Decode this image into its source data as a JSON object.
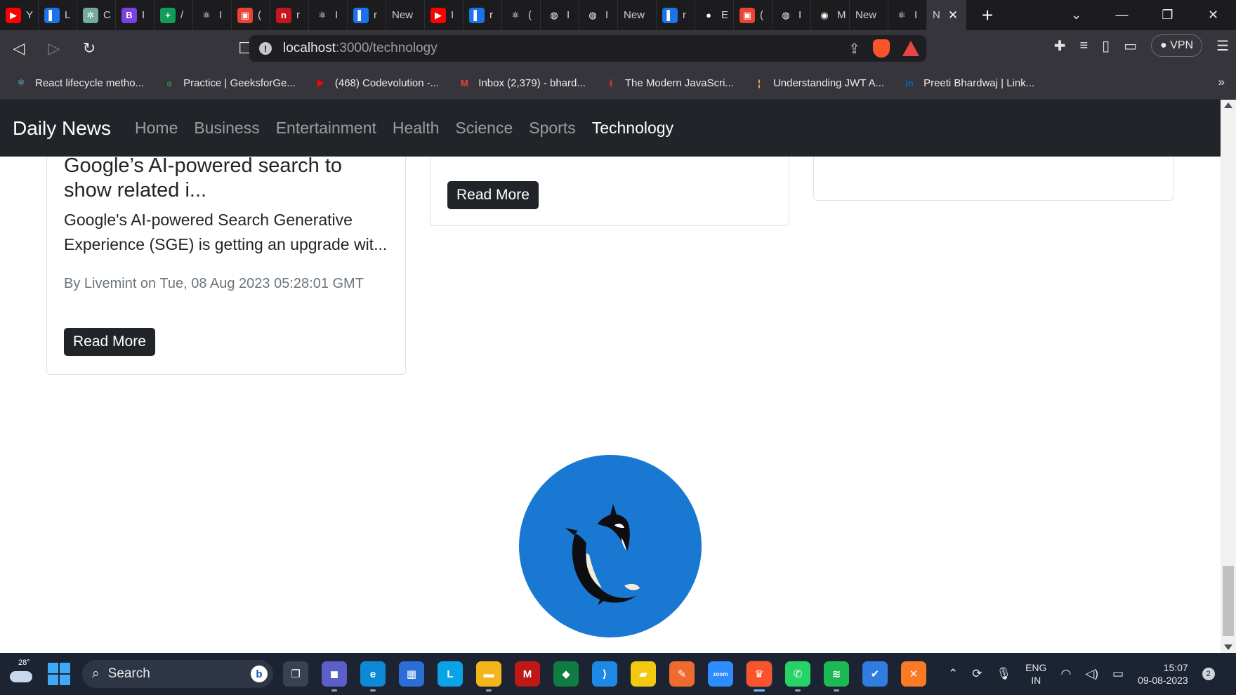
{
  "browser": {
    "tabs": [
      {
        "label": "Y",
        "color": "#ff0000",
        "glyph": "▶"
      },
      {
        "label": "L",
        "color": "#1a73e8",
        "glyph": "▌"
      },
      {
        "label": "C",
        "color": "#74aa9c",
        "glyph": "✲"
      },
      {
        "label": "I",
        "color": "#7b3fe4",
        "glyph": "B"
      },
      {
        "label": "/",
        "color": "#0f9d58",
        "glyph": "+"
      },
      {
        "label": "I",
        "color": "#1c1c1f",
        "glyph": "⚛"
      },
      {
        "label": "(",
        "color": "#ea4335",
        "glyph": "▣"
      },
      {
        "label": "r",
        "color": "#c4161c",
        "glyph": "n"
      },
      {
        "label": "I",
        "color": "#1c1c1f",
        "glyph": "⚛"
      },
      {
        "label": "r",
        "color": "#1a73e8",
        "glyph": "▌"
      },
      {
        "label": "New",
        "color": "#1c1c1f",
        "glyph": ""
      },
      {
        "label": "I",
        "color": "#ff0000",
        "glyph": "▶"
      },
      {
        "label": "r",
        "color": "#1a73e8",
        "glyph": "▌"
      },
      {
        "label": "(",
        "color": "#1c1c1f",
        "glyph": "⚛"
      },
      {
        "label": "I",
        "color": "#1c1c1f",
        "glyph": "◍"
      },
      {
        "label": "I",
        "color": "#1c1c1f",
        "glyph": "◍"
      },
      {
        "label": "New",
        "color": "#1c1c1f",
        "glyph": ""
      },
      {
        "label": "r",
        "color": "#1a73e8",
        "glyph": "▌"
      },
      {
        "label": "E",
        "color": "#1c1c1f",
        "glyph": "●"
      },
      {
        "label": "(",
        "color": "#ea4335",
        "glyph": "▣"
      },
      {
        "label": "I",
        "color": "#1c1c1f",
        "glyph": "◍"
      },
      {
        "label": "M",
        "color": "#1c1c1f",
        "glyph": "◉"
      },
      {
        "label": "New",
        "color": "#1c1c1f",
        "glyph": ""
      },
      {
        "label": "I",
        "color": "#1c1c1f",
        "glyph": "⚛"
      }
    ],
    "active_tab": {
      "label": "N",
      "close": "✕"
    },
    "new_tab": "+",
    "window_controls": {
      "dropdown": "⌄",
      "minimize": "—",
      "restore": "❐",
      "close": "✕"
    },
    "url": {
      "host": "localhost",
      "path": ":3000/technology"
    },
    "vpn_label": "VPN",
    "bookmarks": [
      {
        "label": "React lifecycle metho...",
        "icon": "react-icon",
        "glyph": "⚛",
        "color": "#61dafb"
      },
      {
        "label": "Practice | GeeksforGe...",
        "icon": "gfg-icon",
        "glyph": "ɞ",
        "color": "#2f8d46"
      },
      {
        "label": "(468) Codevolution -...",
        "icon": "youtube-icon",
        "glyph": "▶",
        "color": "#ff0000"
      },
      {
        "label": "Inbox (2,379) - bhard...",
        "icon": "gmail-icon",
        "glyph": "M",
        "color": "#ea4335"
      },
      {
        "label": "The Modern JavaScri...",
        "icon": "javascript-info-icon",
        "glyph": "ᚼ",
        "color": "#e0353c"
      },
      {
        "label": "Understanding JWT A...",
        "icon": "medium-icon",
        "glyph": "¦",
        "color": "#f0c33c"
      },
      {
        "label": "Preeti Bhardwaj | Link...",
        "icon": "linkedin-icon",
        "glyph": "in",
        "color": "#0a66c2"
      }
    ],
    "bookmarks_more": "»"
  },
  "page": {
    "brand": "Daily News",
    "nav_links": [
      "Home",
      "Business",
      "Entertainment",
      "Health",
      "Science",
      "Sports",
      "Technology"
    ],
    "active_nav": "Technology",
    "cards": [
      {
        "title": "Google’s AI-powered search to show related i...",
        "description": "Google's AI-powered Search Generative Experience (SGE) is getting an upgrade wit...",
        "meta": "By Livemint on Tue, 08 Aug 2023 05:28:01 GMT",
        "button": "Read More"
      },
      {
        "button": "Read More"
      }
    ]
  },
  "taskbar": {
    "temperature": "28°",
    "search_placeholder": "Search",
    "bing_glyph": "b",
    "apps": [
      {
        "name": "task-view-icon",
        "glyph": "❐",
        "color": "#3a4252"
      },
      {
        "name": "meet-icon",
        "glyph": "◼",
        "color": "#5b5fc7"
      },
      {
        "name": "edge-icon",
        "glyph": "e",
        "color": "#0c8ad8"
      },
      {
        "name": "store-icon",
        "glyph": "▦",
        "color": "#2b6fd6"
      },
      {
        "name": "l-app-icon",
        "glyph": "L",
        "color": "#0aa3e8"
      },
      {
        "name": "file-explorer-icon",
        "glyph": "▬",
        "color": "#f3b51a"
      },
      {
        "name": "mcafee-icon",
        "glyph": "M",
        "color": "#c01818"
      },
      {
        "name": "mongodb-compass-icon",
        "glyph": "◆",
        "color": "#0f7c42"
      },
      {
        "name": "vscode-icon",
        "glyph": "⟩",
        "color": "#1e88e5"
      },
      {
        "name": "sticky-notes-icon",
        "glyph": "▰",
        "color": "#f2c811"
      },
      {
        "name": "postman-icon",
        "glyph": "✎",
        "color": "#ef6a2e"
      },
      {
        "name": "zoom-icon",
        "glyph": "zoom",
        "color": "#2d8cff"
      },
      {
        "name": "brave-icon",
        "glyph": "♛",
        "color": "#fb542b"
      },
      {
        "name": "whatsapp-icon",
        "glyph": "✆",
        "color": "#25d366"
      },
      {
        "name": "spotify-icon",
        "glyph": "≋",
        "color": "#1db954"
      },
      {
        "name": "todo-icon",
        "glyph": "✔",
        "color": "#2f7de1"
      },
      {
        "name": "xampp-icon",
        "glyph": "✕",
        "color": "#fb7a24"
      }
    ],
    "language": {
      "line1": "ENG",
      "line2": "IN"
    },
    "time": "15:07",
    "date": "09-08-2023",
    "notification_count": "2"
  }
}
